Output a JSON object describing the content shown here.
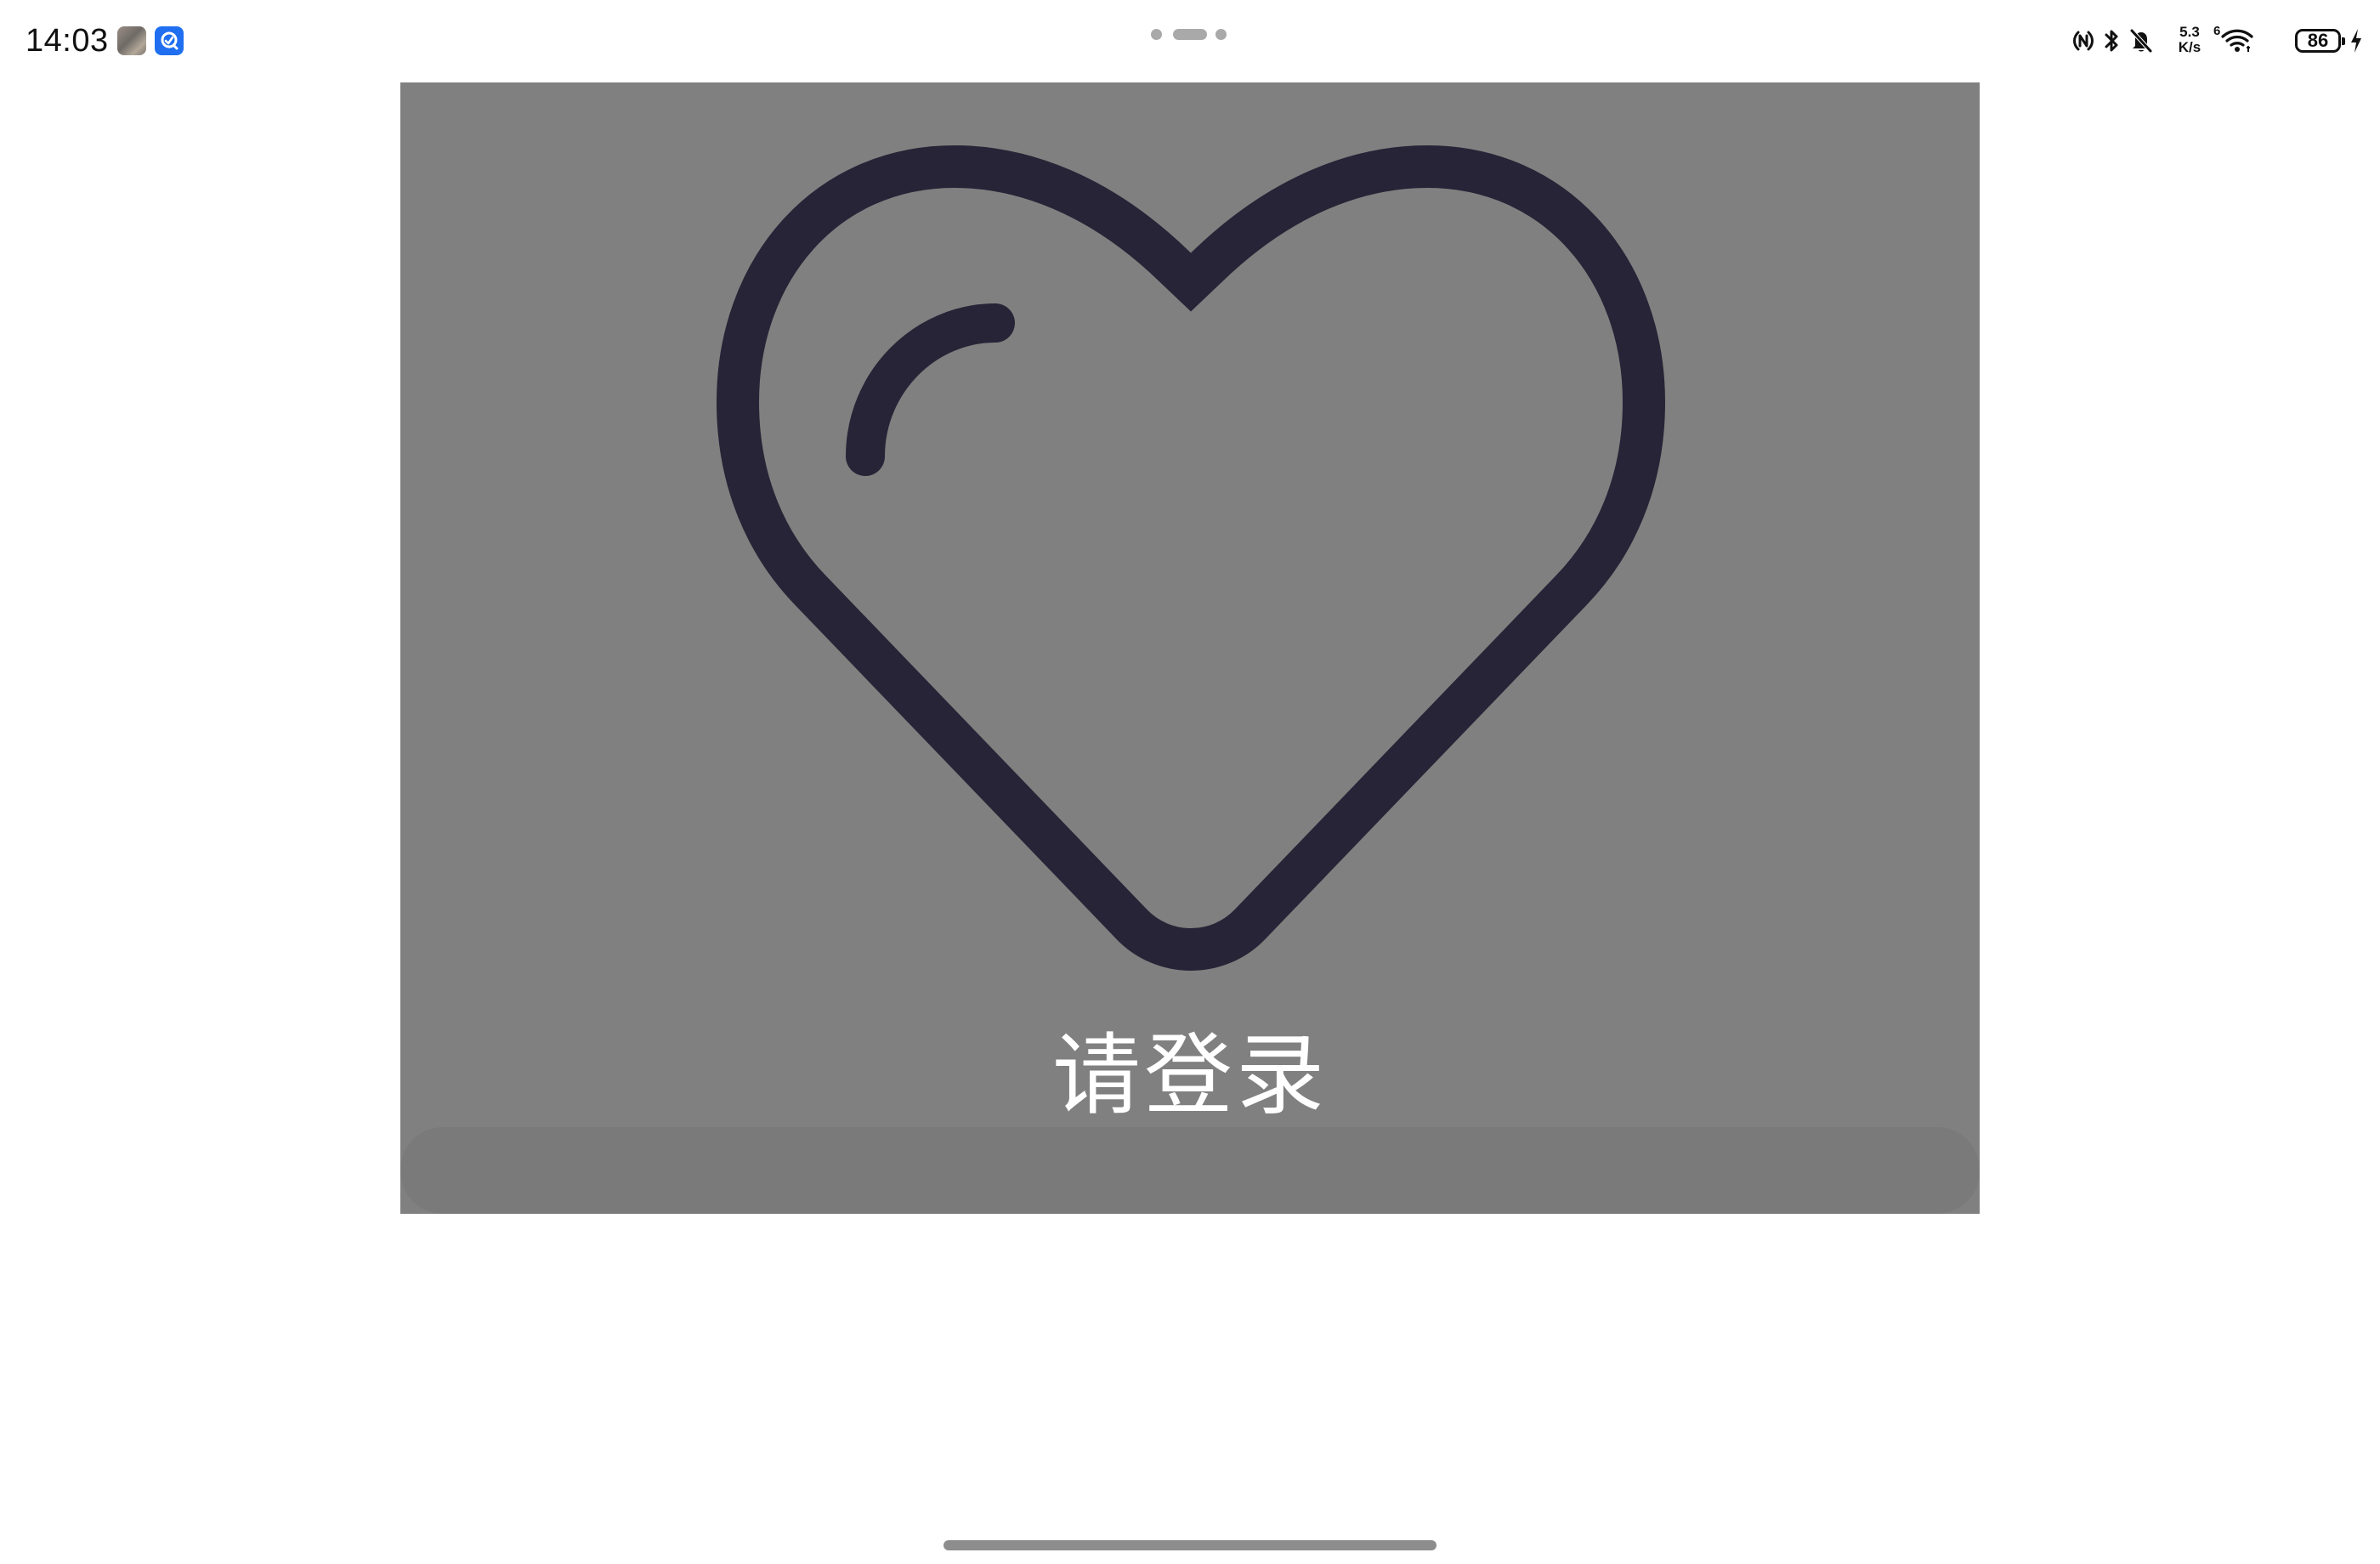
{
  "status_bar": {
    "time": "14:03",
    "notifications": [
      "photo-thumbnail-icon",
      "app-notification-icon"
    ],
    "net_speed_value": "5.3",
    "net_speed_unit": "K/s",
    "network_type": "6",
    "battery_level": "86",
    "icons": [
      "nfc-icon",
      "bluetooth-icon",
      "bell-muted-icon",
      "wifi-icon",
      "battery-icon",
      "charging-bolt-icon"
    ]
  },
  "window_controls": {
    "icon": "multi-window-dots-icon"
  },
  "login_card": {
    "icon": "heart-icon",
    "title": "请登录",
    "background_color": "#808080",
    "icon_color": "#262436"
  },
  "navigation": {
    "home_indicator": "home-indicator"
  }
}
